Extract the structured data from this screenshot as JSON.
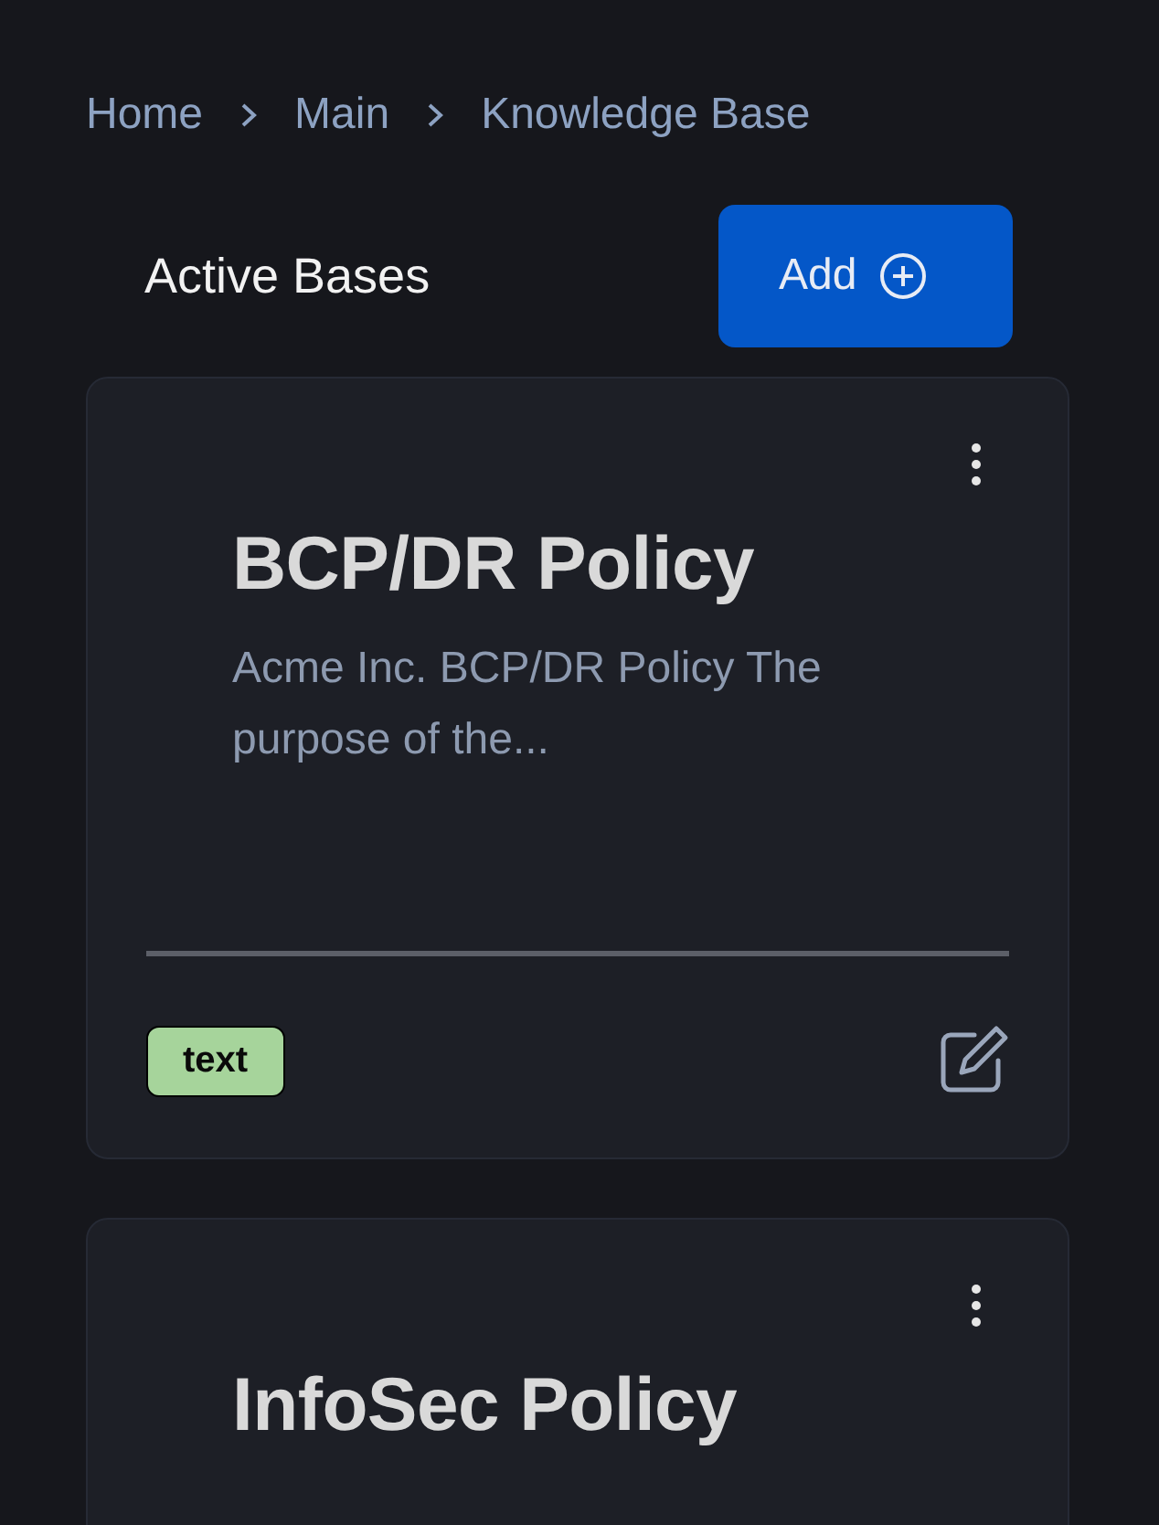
{
  "breadcrumb": [
    {
      "label": "Home"
    },
    {
      "label": "Main"
    },
    {
      "label": "Knowledge Base"
    }
  ],
  "header": {
    "title": "Active Bases",
    "add_button": "Add"
  },
  "cards": [
    {
      "title": "BCP/DR Policy",
      "description": "Acme Inc. BCP/DR Policy The purpose of the...",
      "tag": "text"
    },
    {
      "title": "InfoSec Policy"
    }
  ]
}
